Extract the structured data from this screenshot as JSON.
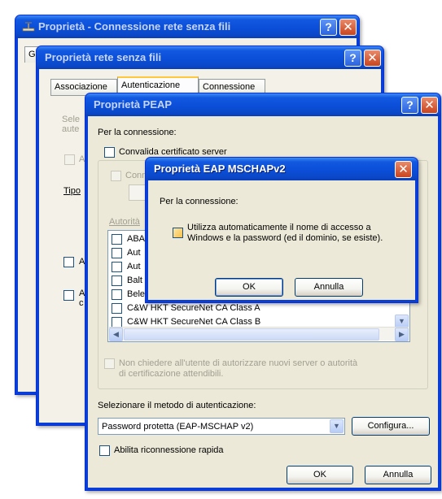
{
  "window1": {
    "title": "Proprietà - Connessione rete senza fili",
    "tab_fragment": "G"
  },
  "window2": {
    "title": "Proprietà rete senza fili",
    "tabs": [
      "Associazione",
      "Autenticazione",
      "Connessione"
    ],
    "text_fragment_1": "Sele",
    "text_fragment_2": "aute",
    "check_fragment_1": "A",
    "label_tipo": "Tipo",
    "check_fragment_2": "A",
    "check_fragment_3": "A",
    "check_fragment_3b": "c"
  },
  "window3": {
    "title": "Proprietà PEAP",
    "section_label": "Per la connessione:",
    "validate_cert_label": "Convalida certificato server",
    "connect_fragment": "Conn",
    "authority_fragment": "Autorità",
    "cert_items": [
      "ABA",
      "Aut",
      "Aut",
      "Balt",
      "Bele",
      "C&W HKT SecureNet CA Class A",
      "C&W HKT SecureNet CA Class B"
    ],
    "no_prompt_label_1": "Non chiedere all'utente di autorizzare nuovi server o autorità",
    "no_prompt_label_2": "di certificazione attendibili.",
    "method_label": "Selezionare il metodo di autenticazione:",
    "method_value": "Password protetta (EAP-MSCHAP v2)",
    "configure_button": "Configura...",
    "fast_reconnect_label": "Abilita riconnessione rapida",
    "ok_button": "OK",
    "cancel_button": "Annulla"
  },
  "window4": {
    "title": "Proprietà EAP MSCHAPv2",
    "section_label": "Per la connessione:",
    "auto_logon_label_1": "Utilizza automaticamente il nome di accesso a",
    "auto_logon_label_2": "Windows e la password (ed il dominio, se esiste).",
    "ok_button": "OK",
    "cancel_button": "Annulla"
  },
  "colors": {
    "titlebar_blue": "#0b4ed8",
    "dialog_face": "#ece9d8",
    "close_red": "#c9441e"
  }
}
